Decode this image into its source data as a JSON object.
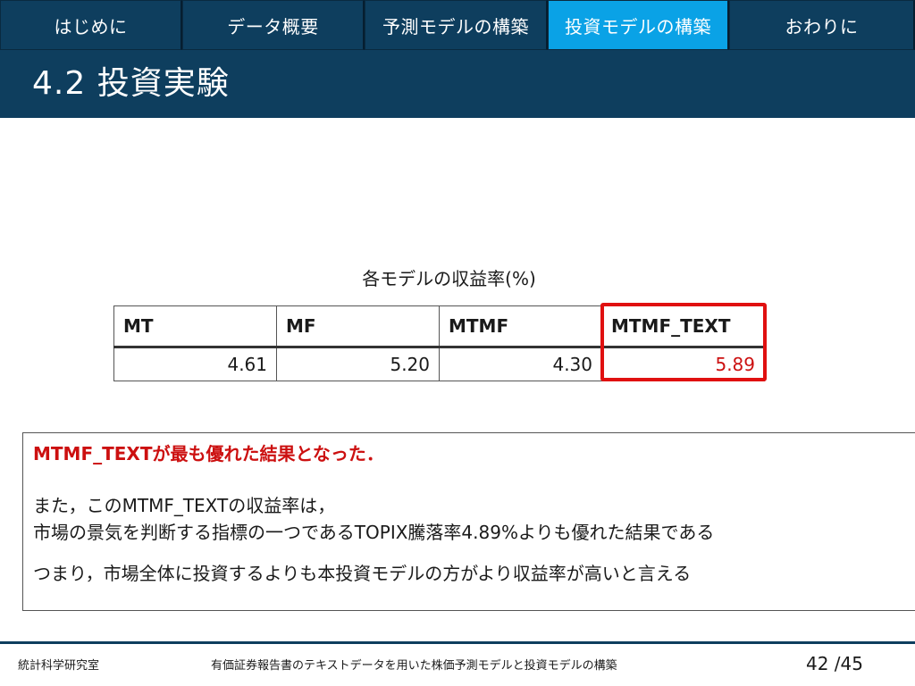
{
  "nav": {
    "tabs": [
      {
        "label": "はじめに",
        "active": false
      },
      {
        "label": "データ概要",
        "active": false
      },
      {
        "label": "予測モデルの構築",
        "active": false
      },
      {
        "label": "投資モデルの構築",
        "active": true
      },
      {
        "label": "おわりに",
        "active": false
      }
    ]
  },
  "header": {
    "title": "4.2 投資実験"
  },
  "table": {
    "caption": "各モデルの収益率(%)",
    "columns": [
      "MT",
      "MF",
      "MTMF",
      "MTMF_TEXT"
    ],
    "values": [
      "4.61",
      "5.20",
      "4.30",
      "5.89"
    ],
    "highlight_column": "MTMF_TEXT",
    "highlight_color": "#e01010"
  },
  "conclusion": {
    "headline": "MTMF_TEXTが最も優れた結果となった．",
    "line1": "また，このMTMF_TEXTの収益率は，",
    "line2": "市場の景気を判断する指標の一つであるTOPIX騰落率4.89%よりも優れた結果である",
    "line3": "つまり，市場全体に投資するよりも本投資モデルの方がより収益率が高いと言える"
  },
  "footer": {
    "lab": "統計科学研究室",
    "presentation_title": "有価証券報告書のテキストデータを用いた株価予測モデルと投資モデルの構築",
    "page": "42 /45"
  },
  "colors": {
    "header_bg": "#0e3e5e",
    "active_tab": "#0aa2e6",
    "accent_red": "#cc1010"
  }
}
